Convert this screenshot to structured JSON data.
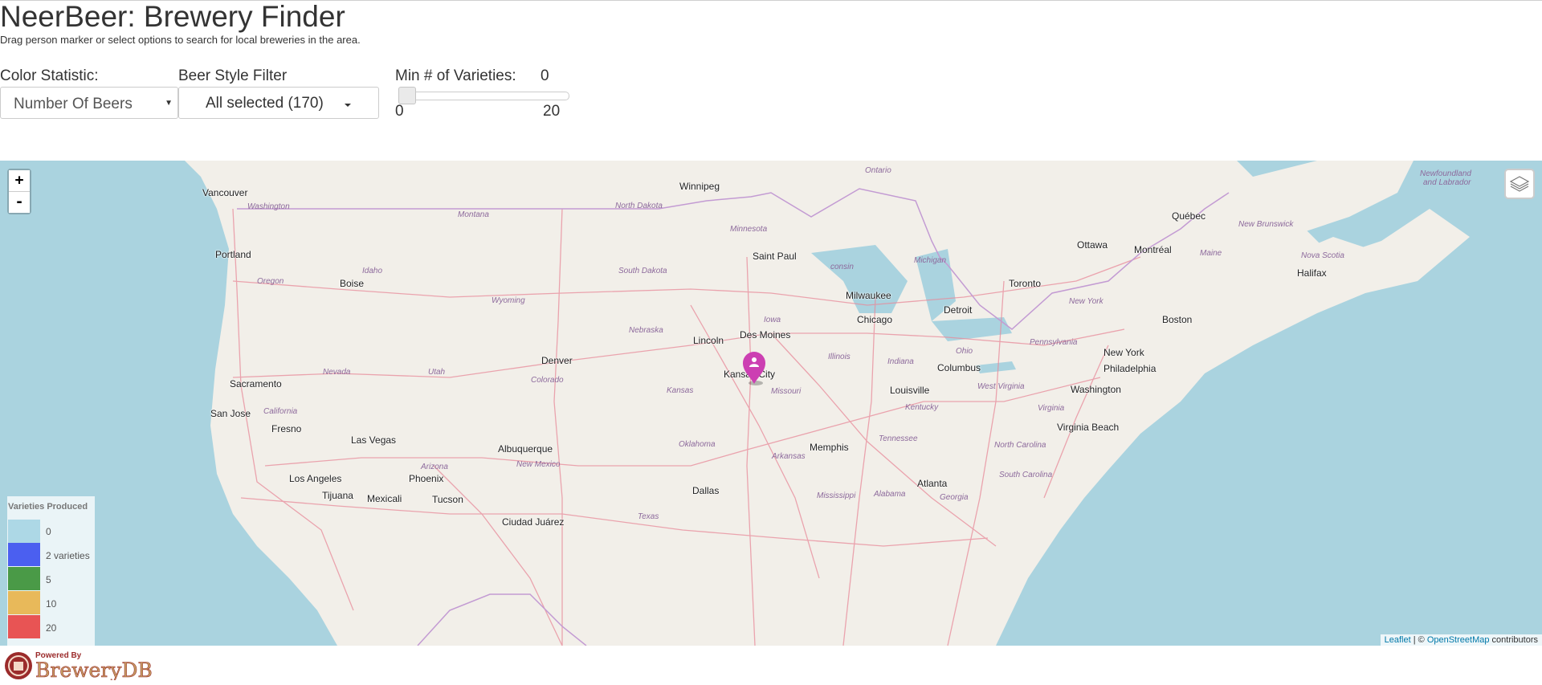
{
  "header": {
    "title": "NeerBeer: Brewery Finder",
    "subtitle": "Drag person marker or select options to search for local breweries in the area."
  },
  "controls": {
    "color_stat_label": "Color Statistic:",
    "color_stat_value": "Number Of Beers",
    "style_filter_label": "Beer Style Filter",
    "style_filter_value": "All selected (170)",
    "min_varieties_label": "Min # of Varieties:",
    "min_varieties_value": "0",
    "slider_min": "0",
    "slider_max": "20"
  },
  "map": {
    "zoom_in": "+",
    "zoom_out": "-",
    "cities": [
      {
        "id": "vancouver",
        "name": "Vancouver"
      },
      {
        "id": "winnipeg",
        "name": "Winnipeg"
      },
      {
        "id": "portland",
        "name": "Portland"
      },
      {
        "id": "boise",
        "name": "Boise"
      },
      {
        "id": "saint-paul",
        "name": "Saint Paul"
      },
      {
        "id": "milwaukee",
        "name": "Milwaukee"
      },
      {
        "id": "chicago",
        "name": "Chicago"
      },
      {
        "id": "detroit",
        "name": "Detroit"
      },
      {
        "id": "toronto",
        "name": "Toronto"
      },
      {
        "id": "ottawa",
        "name": "Ottawa"
      },
      {
        "id": "montreal",
        "name": "Montréal"
      },
      {
        "id": "quebec",
        "name": "Québec"
      },
      {
        "id": "halifax",
        "name": "Halifax"
      },
      {
        "id": "boston",
        "name": "Boston"
      },
      {
        "id": "new-york",
        "name": "New York"
      },
      {
        "id": "philadelphia",
        "name": "Philadelphia"
      },
      {
        "id": "washington",
        "name": "Washington"
      },
      {
        "id": "virginia-beach",
        "name": "Virginia Beach"
      },
      {
        "id": "des-moines",
        "name": "Des Moines"
      },
      {
        "id": "lincoln",
        "name": "Lincoln"
      },
      {
        "id": "denver",
        "name": "Denver"
      },
      {
        "id": "kansas-city",
        "name": "Kansas City"
      },
      {
        "id": "columbus",
        "name": "Columbus"
      },
      {
        "id": "louisville",
        "name": "Louisville"
      },
      {
        "id": "memphis",
        "name": "Memphis"
      },
      {
        "id": "atlanta",
        "name": "Atlanta"
      },
      {
        "id": "dallas",
        "name": "Dallas"
      },
      {
        "id": "albuquerque",
        "name": "Albuquerque"
      },
      {
        "id": "phoenix",
        "name": "Phoenix"
      },
      {
        "id": "tucson",
        "name": "Tucson"
      },
      {
        "id": "las-vegas",
        "name": "Las Vegas"
      },
      {
        "id": "los-angeles",
        "name": "Los Angeles"
      },
      {
        "id": "tijuana",
        "name": "Tijuana"
      },
      {
        "id": "mexicali",
        "name": "Mexicali"
      },
      {
        "id": "ciudad-juarez",
        "name": "Ciudad Juárez"
      },
      {
        "id": "sacramento",
        "name": "Sacramento"
      },
      {
        "id": "san-jose",
        "name": "San Jose"
      },
      {
        "id": "fresno",
        "name": "Fresno"
      }
    ],
    "regions": [
      {
        "id": "ontario",
        "name": "Ontario"
      },
      {
        "id": "newfoundland",
        "name": "Newfoundland"
      },
      {
        "id": "and-labrador",
        "name": "and Labrador"
      },
      {
        "id": "washington-state",
        "name": "Washington"
      },
      {
        "id": "montana",
        "name": "Montana"
      },
      {
        "id": "north-dakota",
        "name": "North Dakota"
      },
      {
        "id": "minnesota",
        "name": "Minnesota"
      },
      {
        "id": "idaho",
        "name": "Idaho"
      },
      {
        "id": "oregon",
        "name": "Oregon"
      },
      {
        "id": "south-dakota",
        "name": "South Dakota"
      },
      {
        "id": "wisconsin",
        "name": "consin"
      },
      {
        "id": "michigan",
        "name": "Michigan"
      },
      {
        "id": "wyoming",
        "name": "Wyoming"
      },
      {
        "id": "iowa",
        "name": "Iowa"
      },
      {
        "id": "nebraska",
        "name": "Nebraska"
      },
      {
        "id": "illinois",
        "name": "Illinois"
      },
      {
        "id": "indiana",
        "name": "Indiana"
      },
      {
        "id": "ohio",
        "name": "Ohio"
      },
      {
        "id": "pennsylvania",
        "name": "Pennsylvania"
      },
      {
        "id": "new-york-state",
        "name": "New York"
      },
      {
        "id": "new-brunswick",
        "name": "New Brunswick"
      },
      {
        "id": "maine",
        "name": "Maine"
      },
      {
        "id": "nova-scotia",
        "name": "Nova Scotia"
      },
      {
        "id": "nevada",
        "name": "Nevada"
      },
      {
        "id": "utah",
        "name": "Utah"
      },
      {
        "id": "colorado",
        "name": "Colorado"
      },
      {
        "id": "kansas",
        "name": "Kansas"
      },
      {
        "id": "missouri",
        "name": "Missouri"
      },
      {
        "id": "kentucky",
        "name": "Kentucky"
      },
      {
        "id": "west-virginia",
        "name": "West Virginia"
      },
      {
        "id": "virginia",
        "name": "Virginia"
      },
      {
        "id": "california",
        "name": "California"
      },
      {
        "id": "oklahoma",
        "name": "Oklahoma"
      },
      {
        "id": "arkansas",
        "name": "Arkansas"
      },
      {
        "id": "tennessee",
        "name": "Tennessee"
      },
      {
        "id": "north-carolina",
        "name": "North Carolina"
      },
      {
        "id": "south-carolina",
        "name": "South Carolina"
      },
      {
        "id": "new-mexico",
        "name": "New Mexico"
      },
      {
        "id": "arizona",
        "name": "Arizona"
      },
      {
        "id": "mississippi",
        "name": "Mississippi"
      },
      {
        "id": "alabama",
        "name": "Alabama"
      },
      {
        "id": "georgia",
        "name": "Georgia"
      },
      {
        "id": "texas",
        "name": "Texas"
      }
    ],
    "legend": {
      "title": "Varieties Produced",
      "items": [
        {
          "label": "0",
          "color": "#add8e6"
        },
        {
          "label": "2 varieties",
          "color": "#4b5ff0"
        },
        {
          "label": "5",
          "color": "#4a9a47"
        },
        {
          "label": "10",
          "color": "#e8b95a"
        },
        {
          "label": "20",
          "color": "#e85454"
        }
      ]
    },
    "attribution": {
      "leaflet": "Leaflet",
      "separator": " | © ",
      "osm": "OpenStreetMap",
      "suffix": " contributors"
    },
    "marker_icon": "person-icon",
    "marker_color": "#cc3fb2"
  },
  "footer": {
    "powered_by": "Powered By",
    "brand": "BreweryDB"
  },
  "colors": {
    "water": "#aad3df",
    "land": "#f2efe9",
    "roads": "#e88a9a",
    "borders": "#c39bd3"
  }
}
